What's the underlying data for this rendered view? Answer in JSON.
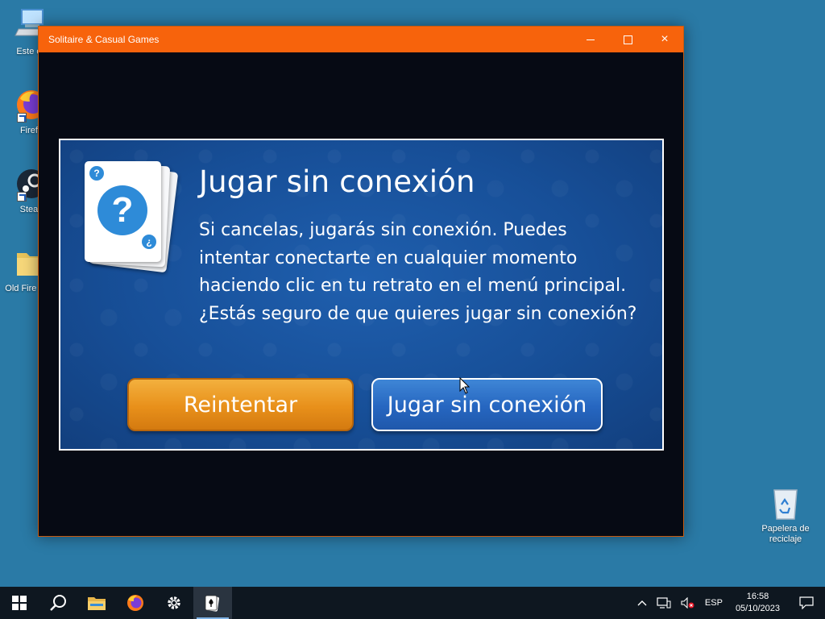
{
  "desktop": {
    "icons": [
      {
        "label": "Este eq",
        "icon": "computer-icon"
      },
      {
        "label": "Firefo",
        "icon": "firefox-icon"
      },
      {
        "label": "Stean",
        "icon": "steam-icon"
      },
      {
        "label": "Old Fire Data",
        "icon": "folder-icon"
      },
      {
        "label": "Papelera de reciclaje",
        "icon": "recycle-bin-icon"
      }
    ]
  },
  "window": {
    "title": "Solitaire & Casual Games",
    "titlebar_color": "#f7630c",
    "controls": {
      "minimize": "minimize-icon",
      "maximize": "maximize-icon",
      "close": "×"
    }
  },
  "dialog": {
    "title": "Jugar sin conexión",
    "body": "Si cancelas, jugarás sin conexión. Puedes intentar conectarte en cualquier momento haciendo clic en tu retrato en el menú principal. ¿Estás seguro de que quieres jugar sin conexión?",
    "cards_icon": {
      "big": "?",
      "top_corner": "?",
      "bottom_corner": "¿"
    },
    "retry_button": "Reintentar",
    "offline_button": "Jugar sin conexión",
    "colors": {
      "retry": "#e8901a",
      "offline": "#2666c0",
      "panel": "#174f98"
    }
  },
  "taskbar": {
    "items": [
      "start-icon",
      "search-icon",
      "file-explorer-icon",
      "firefox-icon",
      "settings-icon",
      "solitaire-icon"
    ],
    "tray": {
      "language": "ESP",
      "time": "16:58",
      "date": "05/10/2023"
    }
  }
}
